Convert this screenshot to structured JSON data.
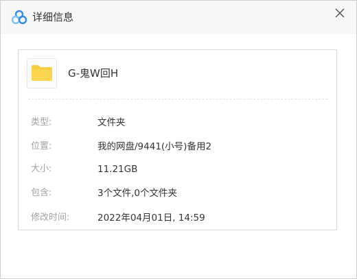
{
  "dialog": {
    "title": "详细信息",
    "logo_icon": "baidu-netdisk-cloud-icon",
    "close_icon": "close-icon"
  },
  "file": {
    "icon": "folder-icon",
    "icon_color": "#f8cd45",
    "name": "G-鬼W回H"
  },
  "properties": [
    {
      "label": "类型:",
      "value": "文件夹"
    },
    {
      "label": "位置:",
      "value": "我的网盘/9441(小号)备用2"
    },
    {
      "label": "大小:",
      "value": "11.21GB"
    },
    {
      "label": "包含:",
      "value": "3个文件,0个文件夹"
    },
    {
      "label": "修改时间:",
      "value": "2022年04月01日, 14:59"
    }
  ],
  "colors": {
    "logo_blue": "#2f8cf0",
    "logo_light": "#7cc1ff",
    "label_gray": "#a3a3a3",
    "text_dark": "#333333"
  }
}
